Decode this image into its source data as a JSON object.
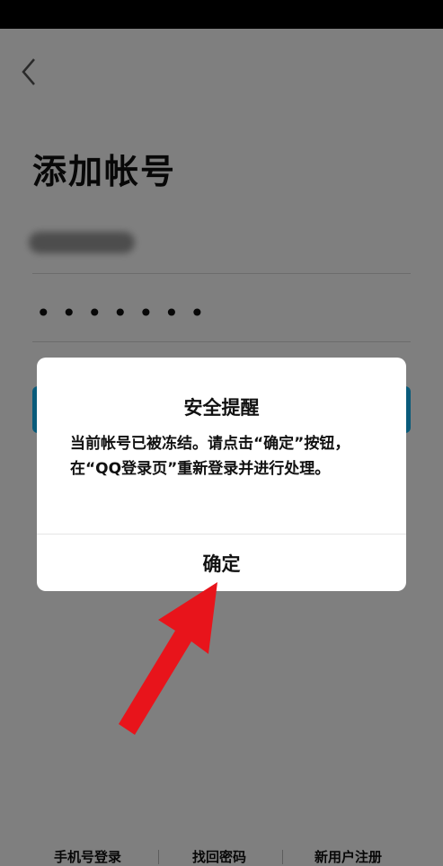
{
  "page": {
    "title": "添加帐号",
    "password_mask": "•••••••"
  },
  "bottom_links": {
    "phone_login": "手机号登录",
    "forgot_password": "找回密码",
    "register": "新用户注册"
  },
  "dialog": {
    "title": "安全提醒",
    "message": "当前帐号已被冻结。请点击“确定”按钮，在“QQ登录页”重新登录并进行处理。",
    "confirm_label": "确定"
  },
  "colors": {
    "accent": "#12b7f5",
    "arrow": "#e8141b"
  }
}
